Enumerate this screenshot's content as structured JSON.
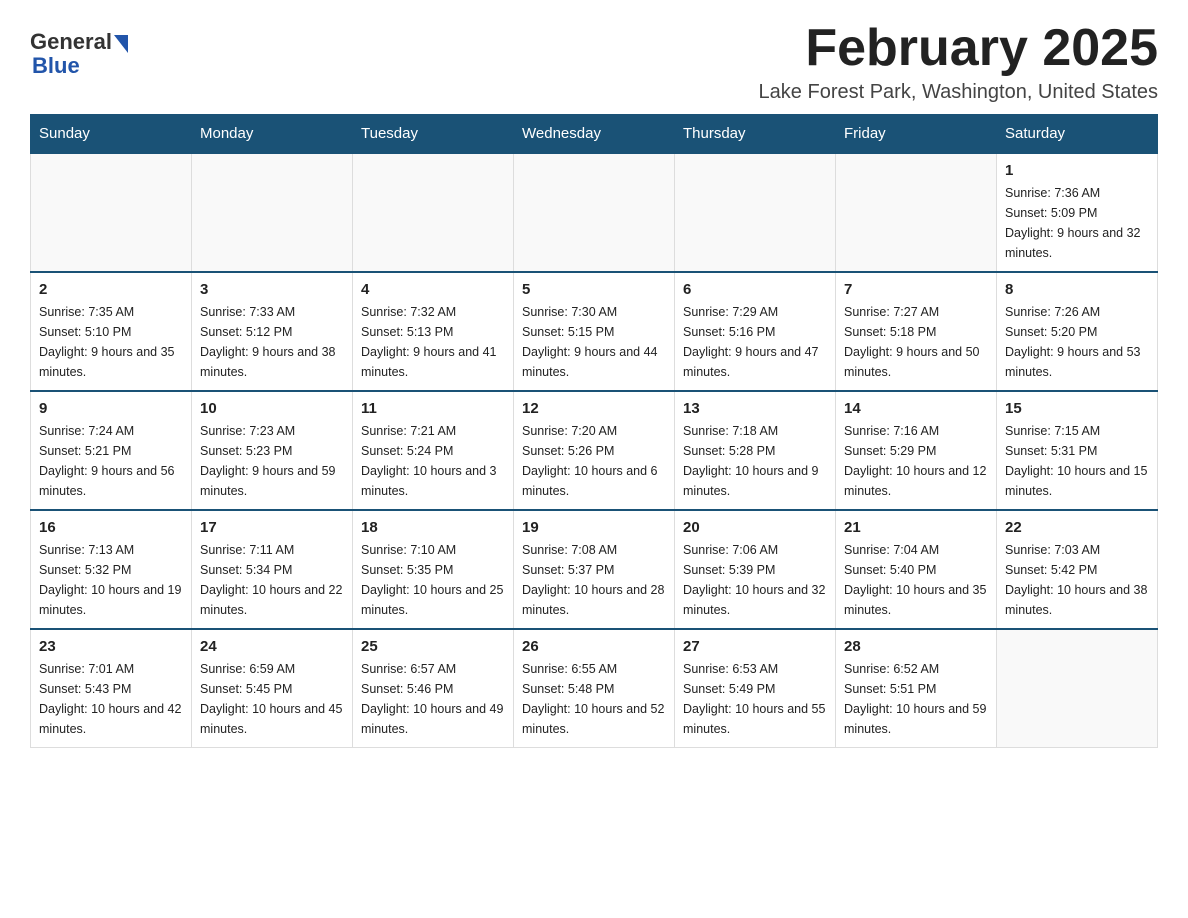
{
  "header": {
    "logo_general": "General",
    "logo_blue": "Blue",
    "title": "February 2025",
    "location": "Lake Forest Park, Washington, United States"
  },
  "days_of_week": [
    "Sunday",
    "Monday",
    "Tuesday",
    "Wednesday",
    "Thursday",
    "Friday",
    "Saturday"
  ],
  "weeks": [
    [
      {
        "day": "",
        "info": ""
      },
      {
        "day": "",
        "info": ""
      },
      {
        "day": "",
        "info": ""
      },
      {
        "day": "",
        "info": ""
      },
      {
        "day": "",
        "info": ""
      },
      {
        "day": "",
        "info": ""
      },
      {
        "day": "1",
        "info": "Sunrise: 7:36 AM\nSunset: 5:09 PM\nDaylight: 9 hours and 32 minutes."
      }
    ],
    [
      {
        "day": "2",
        "info": "Sunrise: 7:35 AM\nSunset: 5:10 PM\nDaylight: 9 hours and 35 minutes."
      },
      {
        "day": "3",
        "info": "Sunrise: 7:33 AM\nSunset: 5:12 PM\nDaylight: 9 hours and 38 minutes."
      },
      {
        "day": "4",
        "info": "Sunrise: 7:32 AM\nSunset: 5:13 PM\nDaylight: 9 hours and 41 minutes."
      },
      {
        "day": "5",
        "info": "Sunrise: 7:30 AM\nSunset: 5:15 PM\nDaylight: 9 hours and 44 minutes."
      },
      {
        "day": "6",
        "info": "Sunrise: 7:29 AM\nSunset: 5:16 PM\nDaylight: 9 hours and 47 minutes."
      },
      {
        "day": "7",
        "info": "Sunrise: 7:27 AM\nSunset: 5:18 PM\nDaylight: 9 hours and 50 minutes."
      },
      {
        "day": "8",
        "info": "Sunrise: 7:26 AM\nSunset: 5:20 PM\nDaylight: 9 hours and 53 minutes."
      }
    ],
    [
      {
        "day": "9",
        "info": "Sunrise: 7:24 AM\nSunset: 5:21 PM\nDaylight: 9 hours and 56 minutes."
      },
      {
        "day": "10",
        "info": "Sunrise: 7:23 AM\nSunset: 5:23 PM\nDaylight: 9 hours and 59 minutes."
      },
      {
        "day": "11",
        "info": "Sunrise: 7:21 AM\nSunset: 5:24 PM\nDaylight: 10 hours and 3 minutes."
      },
      {
        "day": "12",
        "info": "Sunrise: 7:20 AM\nSunset: 5:26 PM\nDaylight: 10 hours and 6 minutes."
      },
      {
        "day": "13",
        "info": "Sunrise: 7:18 AM\nSunset: 5:28 PM\nDaylight: 10 hours and 9 minutes."
      },
      {
        "day": "14",
        "info": "Sunrise: 7:16 AM\nSunset: 5:29 PM\nDaylight: 10 hours and 12 minutes."
      },
      {
        "day": "15",
        "info": "Sunrise: 7:15 AM\nSunset: 5:31 PM\nDaylight: 10 hours and 15 minutes."
      }
    ],
    [
      {
        "day": "16",
        "info": "Sunrise: 7:13 AM\nSunset: 5:32 PM\nDaylight: 10 hours and 19 minutes."
      },
      {
        "day": "17",
        "info": "Sunrise: 7:11 AM\nSunset: 5:34 PM\nDaylight: 10 hours and 22 minutes."
      },
      {
        "day": "18",
        "info": "Sunrise: 7:10 AM\nSunset: 5:35 PM\nDaylight: 10 hours and 25 minutes."
      },
      {
        "day": "19",
        "info": "Sunrise: 7:08 AM\nSunset: 5:37 PM\nDaylight: 10 hours and 28 minutes."
      },
      {
        "day": "20",
        "info": "Sunrise: 7:06 AM\nSunset: 5:39 PM\nDaylight: 10 hours and 32 minutes."
      },
      {
        "day": "21",
        "info": "Sunrise: 7:04 AM\nSunset: 5:40 PM\nDaylight: 10 hours and 35 minutes."
      },
      {
        "day": "22",
        "info": "Sunrise: 7:03 AM\nSunset: 5:42 PM\nDaylight: 10 hours and 38 minutes."
      }
    ],
    [
      {
        "day": "23",
        "info": "Sunrise: 7:01 AM\nSunset: 5:43 PM\nDaylight: 10 hours and 42 minutes."
      },
      {
        "day": "24",
        "info": "Sunrise: 6:59 AM\nSunset: 5:45 PM\nDaylight: 10 hours and 45 minutes."
      },
      {
        "day": "25",
        "info": "Sunrise: 6:57 AM\nSunset: 5:46 PM\nDaylight: 10 hours and 49 minutes."
      },
      {
        "day": "26",
        "info": "Sunrise: 6:55 AM\nSunset: 5:48 PM\nDaylight: 10 hours and 52 minutes."
      },
      {
        "day": "27",
        "info": "Sunrise: 6:53 AM\nSunset: 5:49 PM\nDaylight: 10 hours and 55 minutes."
      },
      {
        "day": "28",
        "info": "Sunrise: 6:52 AM\nSunset: 5:51 PM\nDaylight: 10 hours and 59 minutes."
      },
      {
        "day": "",
        "info": ""
      }
    ]
  ]
}
